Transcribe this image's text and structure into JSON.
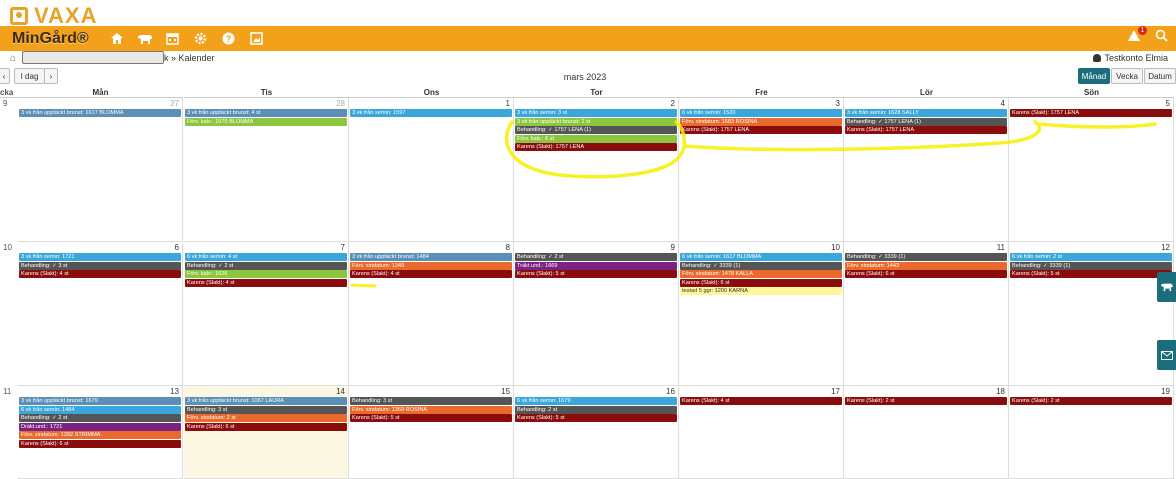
{
  "logo": "VAXA",
  "app_title": "MinGård®",
  "nav_icons": [
    "home-icon",
    "cow-icon",
    "calendar-icon",
    "gear-icon",
    "help-icon",
    "image-icon"
  ],
  "alert_count": "1",
  "breadcrumb": {
    "tail": "k » Kalender"
  },
  "user": "Testkonto Elmia",
  "toolbar": {
    "today": "I dag",
    "next": "›",
    "prev": "‹",
    "title": "mars 2023",
    "views": [
      "Månad",
      "Vecka",
      "Datum"
    ],
    "active_view": "Månad"
  },
  "week_label": "cka",
  "weekdays": [
    "Mån",
    "Tis",
    "Ons",
    "Tor",
    "Fre",
    "Lör",
    "Sön"
  ],
  "colors": {
    "blue": "#3aa7dc",
    "teal": "#5a8fb8",
    "green": "#8cc63f",
    "darkgray": "#555555",
    "darkred": "#8b0c0c",
    "orange": "#e96a2c",
    "purple": "#7b2382",
    "yellow": "#fff59b",
    "accent": "#1a6d7a",
    "brand": "#f3a01b"
  },
  "weeks": [
    {
      "num": "9",
      "days": [
        {
          "n": "27",
          "muted": true,
          "ev": [
            [
              "teal",
              "3 vk från upptäckt brunst: 1617 BLOMMA"
            ]
          ]
        },
        {
          "n": "28",
          "muted": true,
          "ev": [
            [
              "teal",
              "3 vk från upptäckt brunst: 4 st"
            ],
            [
              "green",
              "Förv. kalv.: 1579 BLOMMA"
            ]
          ]
        },
        {
          "n": "1",
          "ev": [
            [
              "blue",
              "3 vk från semin: 1597"
            ]
          ]
        },
        {
          "n": "2",
          "ev": [
            [
              "blue",
              "3 vk från semin: 3 st"
            ],
            [
              "green",
              "3 vk från upptäckt brunst: 2 st"
            ],
            [
              "darkgray",
              "Behandling: ✓ 1757 LENA (1)"
            ],
            [
              "green",
              "Förv. kalv.: 6 st"
            ],
            [
              "darkred",
              "Karens (Slakt): 1757 LENA"
            ]
          ]
        },
        {
          "n": "3",
          "ev": [
            [
              "blue",
              "6 vk från semin: 1520"
            ],
            [
              "orange",
              "Förv. sindatum: 1583 ROSINA"
            ],
            [
              "darkred",
              "Karens (Slakt): 1757 LENA"
            ]
          ]
        },
        {
          "n": "4",
          "ev": [
            [
              "blue",
              "3 vk från semin: 1628 SALLY"
            ],
            [
              "darkgray",
              "Behandling: ✓ 1757 LENA (1)"
            ],
            [
              "darkred",
              "Karens (Slakt): 1757 LENA"
            ]
          ]
        },
        {
          "n": "5",
          "ev": [
            [
              "darkred",
              "Karens (Slakt): 1757 LENA"
            ]
          ]
        }
      ]
    },
    {
      "num": "10",
      "days": [
        {
          "n": "6",
          "ev": [
            [
              "blue",
              "3 vk från semin: 1721"
            ],
            [
              "darkgray",
              "Behandling: ✓ 3 st"
            ],
            [
              "darkred",
              "Karens (Slakt): 4 st"
            ]
          ]
        },
        {
          "n": "7",
          "ev": [
            [
              "blue",
              "6 vk från semin: 4 st"
            ],
            [
              "darkgray",
              "Behandling: ✓ 2 st"
            ],
            [
              "green",
              "Förv. kalv.: 1626"
            ],
            [
              "darkred",
              "Karens (Slakt): 4 st"
            ]
          ]
        },
        {
          "n": "8",
          "ev": [
            [
              "teal",
              "3 vk från upptäckt brunst: 1484"
            ],
            [
              "orange",
              "Förv. sindatum: 1349"
            ],
            [
              "darkred",
              "Karens (Slakt): 4 st"
            ]
          ]
        },
        {
          "n": "9",
          "ev": [
            [
              "darkgray",
              "Behandling: ✓ 2 st"
            ],
            [
              "purple",
              "Träkt.und.: 1669"
            ],
            [
              "darkred",
              "Karens (Slakt): 5 st"
            ]
          ]
        },
        {
          "n": "10",
          "ev": [
            [
              "blue",
              "6 vk från semin: 1617 BLOMMA"
            ],
            [
              "darkgray",
              "Behandling: ✓ 3339 (1)"
            ],
            [
              "orange",
              "Förv. sindatum: 1478 KALLA"
            ],
            [
              "darkred",
              "Karens (Slakt): 6 st"
            ],
            [
              "yellow",
              "testad 5 ggr: 1200 KARNA"
            ]
          ]
        },
        {
          "n": "11",
          "ev": [
            [
              "darkgray",
              "Behandling: ✓ 3339 (1)"
            ],
            [
              "orange",
              "Förv. sindatum: 1443"
            ],
            [
              "darkred",
              "Karens (Slakt): 6 st"
            ]
          ]
        },
        {
          "n": "12",
          "ev": [
            [
              "blue",
              "6 vk från semin: 2 st"
            ],
            [
              "darkgray",
              "Behandling: ✓ 3339 (1)"
            ],
            [
              "darkred",
              "Karens (Slakt): 5 st"
            ]
          ]
        }
      ]
    },
    {
      "num": "11",
      "days": [
        {
          "n": "13",
          "ev": [
            [
              "teal",
              "3 vk från upptäckt brunst: 1679"
            ],
            [
              "blue",
              "6 vk från semin: 1484"
            ],
            [
              "darkgray",
              "Behandling: ✓ 2 st"
            ],
            [
              "purple",
              "Dräkt.und.: 1721"
            ],
            [
              "orange",
              "Förv. sindatum: 1392 STRIMMA"
            ],
            [
              "darkred",
              "Karens (Slakt): 6 st"
            ]
          ]
        },
        {
          "n": "14",
          "today": true,
          "ev": [
            [
              "teal",
              "3 vk från upptäckt brunst: 1067 LAURA"
            ],
            [
              "darkgray",
              "Behandling: 3 st"
            ],
            [
              "orange",
              "Förv. sindatum: 2 st"
            ],
            [
              "darkred",
              "Karens (Slakt): 6 st"
            ]
          ]
        },
        {
          "n": "15",
          "ev": [
            [
              "darkgray",
              "Behandling: 3 st"
            ],
            [
              "orange",
              "Förv. sindatum: 1369 ROSINA"
            ],
            [
              "darkred",
              "Karens (Slakt): 5 st"
            ]
          ]
        },
        {
          "n": "16",
          "ev": [
            [
              "blue",
              "6 vk från semin: 1679"
            ],
            [
              "darkgray",
              "Behandling: 2 st"
            ],
            [
              "darkred",
              "Karens (Slakt): 5 st"
            ]
          ]
        },
        {
          "n": "17",
          "ev": [
            [
              "darkred",
              "Karens (Slakt): 4 st"
            ]
          ]
        },
        {
          "n": "18",
          "ev": [
            [
              "darkred",
              "Karens (Slakt): 2 st"
            ]
          ]
        },
        {
          "n": "19",
          "ev": [
            [
              "darkred",
              "Karens (Slakt): 2 st"
            ]
          ]
        }
      ]
    }
  ],
  "side_buttons": [
    "cow-icon",
    "mail-icon"
  ]
}
